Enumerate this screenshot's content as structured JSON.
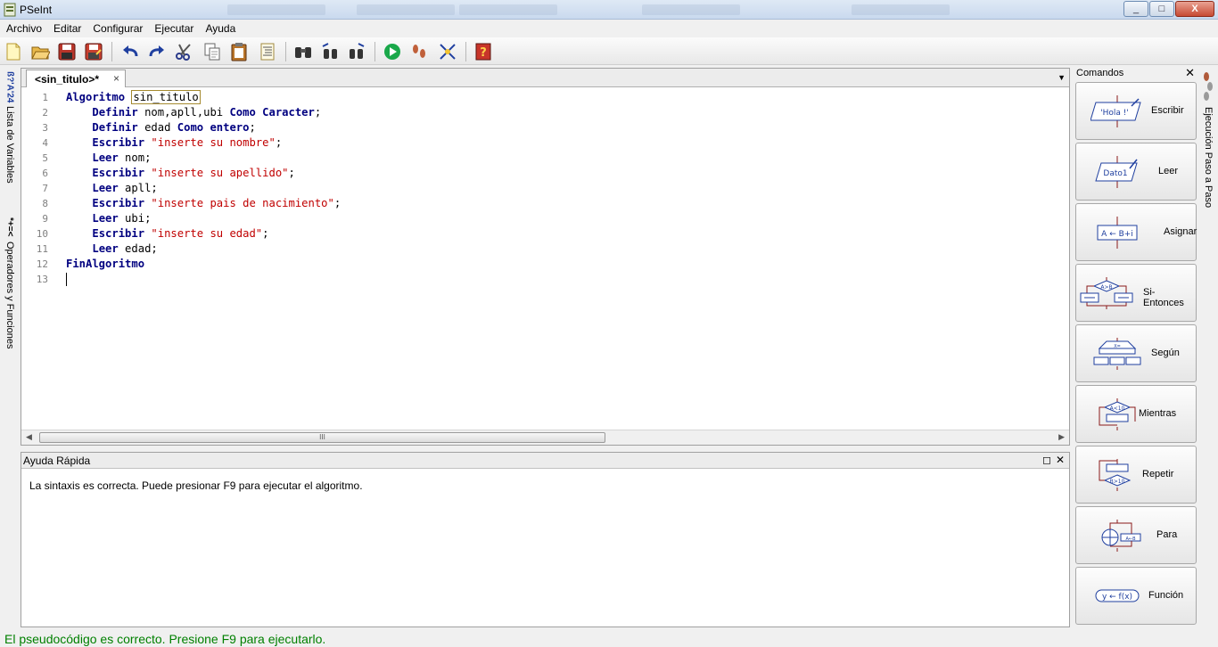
{
  "window": {
    "title": "PSeInt",
    "min": "_",
    "max": "□",
    "close": "X"
  },
  "menu": [
    "Archivo",
    "Editar",
    "Configurar",
    "Ejecutar",
    "Ayuda"
  ],
  "left_tabs": {
    "variables": {
      "symbols": "*+=<",
      "label": "Lista de Variables"
    },
    "operators": {
      "symbols": "ß?'A'24",
      "label": "Operadores y Funciones"
    }
  },
  "right_tab": {
    "label": "Ejecución Paso a Paso"
  },
  "editor": {
    "tab_label": "<sin_titulo>*",
    "tab_close": "×",
    "scroll_grip": "III",
    "lines": [
      {
        "n": "1"
      },
      {
        "n": "2"
      },
      {
        "n": "3"
      },
      {
        "n": "4"
      },
      {
        "n": "5"
      },
      {
        "n": "6"
      },
      {
        "n": "7"
      },
      {
        "n": "8"
      },
      {
        "n": "9"
      },
      {
        "n": "10"
      },
      {
        "n": "11"
      },
      {
        "n": "12"
      },
      {
        "n": "13"
      }
    ],
    "code": {
      "l1_kw": "Algoritmo",
      "l1_name": "sin_titulo",
      "l2_kw": "Definir",
      "l2_vars": " nom,apll,ubi ",
      "l2_kw2": "Como Caracter",
      "l2_end": ";",
      "l3_kw": "Definir",
      "l3_vars": " edad ",
      "l3_kw2": "Como entero",
      "l3_end": ";",
      "l4_kw": "Escribir",
      "l4_str": "\"inserte su nombre\"",
      "l4_end": ";",
      "l5_kw": "Leer",
      "l5_var": " nom;",
      "l6_kw": "Escribir",
      "l6_str": "\"inserte su apellido\"",
      "l6_end": ";",
      "l7_kw": "Leer",
      "l7_var": " apll;",
      "l8_kw": "Escribir",
      "l8_str": "\"inserte pais de nacimiento\"",
      "l8_end": ";",
      "l9_kw": "Leer",
      "l9_var": " ubi;",
      "l10_kw": "Escribir",
      "l10_str": "\"inserte su edad\"",
      "l10_end": ";",
      "l11_kw": "Leer",
      "l11_var": " edad;",
      "l12_kw": "FinAlgoritmo"
    }
  },
  "quick_help": {
    "title": "Ayuda Rápida",
    "restore": "◻",
    "close": "✕",
    "message": "La sintaxis es correcta. Puede presionar F9 para ejecutar el algoritmo."
  },
  "commands": {
    "title": "Comandos",
    "close": "✕",
    "items": [
      {
        "label": "Escribir",
        "icon_text": "'Hola !'"
      },
      {
        "label": "Leer",
        "icon_text": "Dato1"
      },
      {
        "label": "Asignar",
        "icon_text": "A ← B+i"
      },
      {
        "label": "Si-Entonces",
        "icon_text": "A>B"
      },
      {
        "label": "Según",
        "icon_text": "X="
      },
      {
        "label": "Mientras",
        "icon_text": "A<10"
      },
      {
        "label": "Repetir",
        "icon_text": "B>10"
      },
      {
        "label": "Para",
        "icon_text": "A←B"
      },
      {
        "label": "Función",
        "icon_text": "y ← f(x)"
      }
    ]
  },
  "status": {
    "message": "El pseudocódigo es correcto. Presione F9 para ejecutarlo."
  },
  "colors": {
    "keyword": "#000080",
    "string": "#c00000",
    "status": "#008000"
  }
}
